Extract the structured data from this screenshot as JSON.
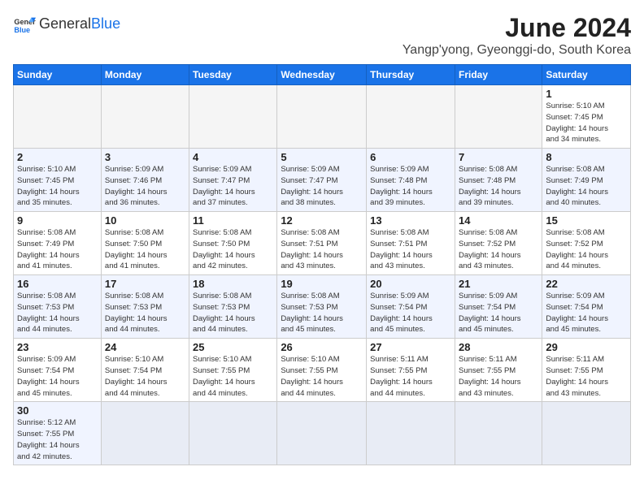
{
  "header": {
    "logo_general": "General",
    "logo_blue": "Blue",
    "month_title": "June 2024",
    "location": "Yangp'yong, Gyeonggi-do, South Korea"
  },
  "days_of_week": [
    "Sunday",
    "Monday",
    "Tuesday",
    "Wednesday",
    "Thursday",
    "Friday",
    "Saturday"
  ],
  "weeks": [
    [
      {
        "day": "",
        "info": ""
      },
      {
        "day": "",
        "info": ""
      },
      {
        "day": "",
        "info": ""
      },
      {
        "day": "",
        "info": ""
      },
      {
        "day": "",
        "info": ""
      },
      {
        "day": "",
        "info": ""
      },
      {
        "day": "1",
        "info": "Sunrise: 5:10 AM\nSunset: 7:45 PM\nDaylight: 14 hours\nand 34 minutes."
      }
    ],
    [
      {
        "day": "2",
        "info": "Sunrise: 5:10 AM\nSunset: 7:45 PM\nDaylight: 14 hours\nand 35 minutes."
      },
      {
        "day": "3",
        "info": "Sunrise: 5:09 AM\nSunset: 7:46 PM\nDaylight: 14 hours\nand 36 minutes."
      },
      {
        "day": "4",
        "info": "Sunrise: 5:09 AM\nSunset: 7:47 PM\nDaylight: 14 hours\nand 37 minutes."
      },
      {
        "day": "5",
        "info": "Sunrise: 5:09 AM\nSunset: 7:47 PM\nDaylight: 14 hours\nand 38 minutes."
      },
      {
        "day": "6",
        "info": "Sunrise: 5:09 AM\nSunset: 7:48 PM\nDaylight: 14 hours\nand 39 minutes."
      },
      {
        "day": "7",
        "info": "Sunrise: 5:08 AM\nSunset: 7:48 PM\nDaylight: 14 hours\nand 39 minutes."
      },
      {
        "day": "8",
        "info": "Sunrise: 5:08 AM\nSunset: 7:49 PM\nDaylight: 14 hours\nand 40 minutes."
      }
    ],
    [
      {
        "day": "9",
        "info": "Sunrise: 5:08 AM\nSunset: 7:49 PM\nDaylight: 14 hours\nand 41 minutes."
      },
      {
        "day": "10",
        "info": "Sunrise: 5:08 AM\nSunset: 7:50 PM\nDaylight: 14 hours\nand 41 minutes."
      },
      {
        "day": "11",
        "info": "Sunrise: 5:08 AM\nSunset: 7:50 PM\nDaylight: 14 hours\nand 42 minutes."
      },
      {
        "day": "12",
        "info": "Sunrise: 5:08 AM\nSunset: 7:51 PM\nDaylight: 14 hours\nand 43 minutes."
      },
      {
        "day": "13",
        "info": "Sunrise: 5:08 AM\nSunset: 7:51 PM\nDaylight: 14 hours\nand 43 minutes."
      },
      {
        "day": "14",
        "info": "Sunrise: 5:08 AM\nSunset: 7:52 PM\nDaylight: 14 hours\nand 43 minutes."
      },
      {
        "day": "15",
        "info": "Sunrise: 5:08 AM\nSunset: 7:52 PM\nDaylight: 14 hours\nand 44 minutes."
      }
    ],
    [
      {
        "day": "16",
        "info": "Sunrise: 5:08 AM\nSunset: 7:53 PM\nDaylight: 14 hours\nand 44 minutes."
      },
      {
        "day": "17",
        "info": "Sunrise: 5:08 AM\nSunset: 7:53 PM\nDaylight: 14 hours\nand 44 minutes."
      },
      {
        "day": "18",
        "info": "Sunrise: 5:08 AM\nSunset: 7:53 PM\nDaylight: 14 hours\nand 44 minutes."
      },
      {
        "day": "19",
        "info": "Sunrise: 5:08 AM\nSunset: 7:53 PM\nDaylight: 14 hours\nand 45 minutes."
      },
      {
        "day": "20",
        "info": "Sunrise: 5:09 AM\nSunset: 7:54 PM\nDaylight: 14 hours\nand 45 minutes."
      },
      {
        "day": "21",
        "info": "Sunrise: 5:09 AM\nSunset: 7:54 PM\nDaylight: 14 hours\nand 45 minutes."
      },
      {
        "day": "22",
        "info": "Sunrise: 5:09 AM\nSunset: 7:54 PM\nDaylight: 14 hours\nand 45 minutes."
      }
    ],
    [
      {
        "day": "23",
        "info": "Sunrise: 5:09 AM\nSunset: 7:54 PM\nDaylight: 14 hours\nand 45 minutes."
      },
      {
        "day": "24",
        "info": "Sunrise: 5:10 AM\nSunset: 7:54 PM\nDaylight: 14 hours\nand 44 minutes."
      },
      {
        "day": "25",
        "info": "Sunrise: 5:10 AM\nSunset: 7:55 PM\nDaylight: 14 hours\nand 44 minutes."
      },
      {
        "day": "26",
        "info": "Sunrise: 5:10 AM\nSunset: 7:55 PM\nDaylight: 14 hours\nand 44 minutes."
      },
      {
        "day": "27",
        "info": "Sunrise: 5:11 AM\nSunset: 7:55 PM\nDaylight: 14 hours\nand 44 minutes."
      },
      {
        "day": "28",
        "info": "Sunrise: 5:11 AM\nSunset: 7:55 PM\nDaylight: 14 hours\nand 43 minutes."
      },
      {
        "day": "29",
        "info": "Sunrise: 5:11 AM\nSunset: 7:55 PM\nDaylight: 14 hours\nand 43 minutes."
      }
    ],
    [
      {
        "day": "30",
        "info": "Sunrise: 5:12 AM\nSunset: 7:55 PM\nDaylight: 14 hours\nand 42 minutes."
      },
      {
        "day": "",
        "info": ""
      },
      {
        "day": "",
        "info": ""
      },
      {
        "day": "",
        "info": ""
      },
      {
        "day": "",
        "info": ""
      },
      {
        "day": "",
        "info": ""
      },
      {
        "day": "",
        "info": ""
      }
    ]
  ]
}
